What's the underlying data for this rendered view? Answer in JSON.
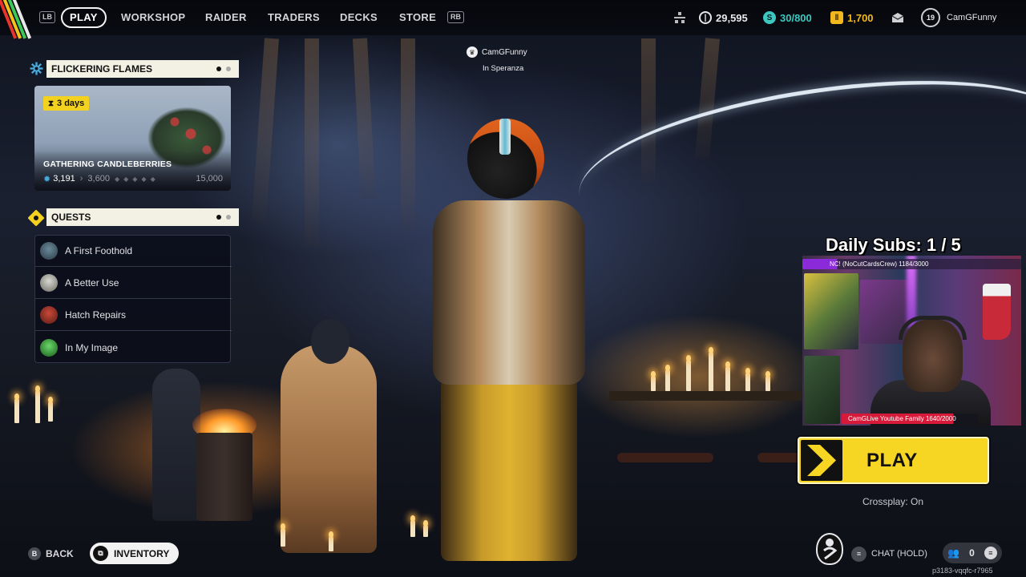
{
  "nav": {
    "left_shoulder": "LB",
    "right_shoulder": "RB",
    "tabs": [
      "PLAY",
      "WORKSHOP",
      "RAIDER",
      "TRADERS",
      "DECKS",
      "STORE"
    ],
    "active_tab": "PLAY"
  },
  "currencies": {
    "coins": "29,595",
    "seeds": "30/800",
    "raider_tokens": "1,700"
  },
  "profile": {
    "level": "19",
    "username": "CamGFunny"
  },
  "event": {
    "title": "FLICKERING FLAMES",
    "time_left": "3 days",
    "task": "GATHERING CANDLEBERRIES",
    "progress_current": "3,191",
    "progress_next": "3,600",
    "progress_max": "15,000"
  },
  "quests": {
    "title": "QUESTS",
    "items": [
      {
        "label": "A First Foothold"
      },
      {
        "label": "A Better Use"
      },
      {
        "label": "Hatch Repairs"
      },
      {
        "label": "In My Image"
      }
    ]
  },
  "player_tag": {
    "name": "CamGFunny",
    "location": "In Speranza"
  },
  "stream": {
    "daily_subs": "Daily Subs: 1 / 5",
    "goal_top": "NC! (NoCutCardsCrew) 1184/3000",
    "goal_bottom_left": "CamGLive Youtube Family 1640",
    "goal_bottom_right": "/2000"
  },
  "play": {
    "label": "PLAY",
    "crossplay": "Crossplay: On"
  },
  "bottom": {
    "back_key": "B",
    "back_label": "BACK",
    "inventory_label": "INVENTORY",
    "chat_label": "CHAT (HOLD)",
    "friends_count": "0",
    "session_id": "p3183-vqqfc-r7965"
  },
  "colors": {
    "accent_yellow": "#f6d622",
    "panel_header": "#f3f1e4",
    "seeds_teal": "#3cc8c0",
    "token_gold": "#f2b81e"
  }
}
